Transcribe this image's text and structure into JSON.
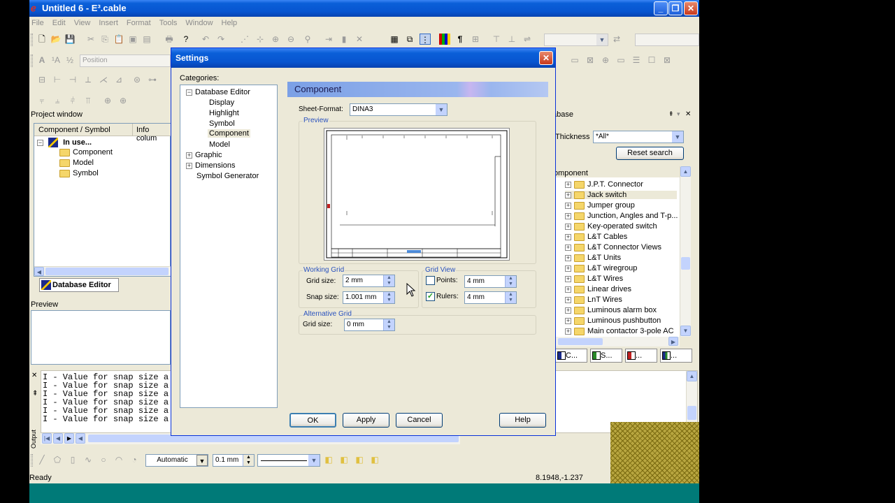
{
  "window": {
    "title": "Untitled 6 - E³.cable"
  },
  "menu": [
    "File",
    "Edit",
    "View",
    "Insert",
    "Format",
    "Tools",
    "Window",
    "Help"
  ],
  "toolbar": {
    "position_label": "Position"
  },
  "project_window": {
    "title": "Project window",
    "col1": "Component / Symbol",
    "col2": "Info colum",
    "root": "In use...",
    "children": [
      "Component",
      "Model",
      "Symbol"
    ],
    "tab": "Database Editor"
  },
  "preview_panel": {
    "title": "Preview"
  },
  "output": {
    "lines": [
      "I - Value for snap size a",
      "I - Value for snap size a",
      "I - Value for snap size a",
      "I - Value for snap size a",
      "I - Value for snap size a",
      "I - Value for snap size a"
    ],
    "label": "Output"
  },
  "bottom_toolbar": {
    "line_mode": "Automatic",
    "line_width": "0.1 mm"
  },
  "status": {
    "left": "Ready",
    "coords": "8.1948,-1.237"
  },
  "database": {
    "title": "abase",
    "thickness_label": "Thickness",
    "thickness_value": "*All*",
    "reset_label": "Reset search",
    "component_label": "omponent",
    "items": [
      "J.P.T. Connector",
      "Jack switch",
      "Jumper group",
      "Junction, Angles and T-p...",
      "Key-operated switch",
      "L&T Cables",
      "L&T Connector Views",
      "L&T Units",
      "L&T wiregroup",
      "L&T Wires",
      "Linear drives",
      "LnT Wires",
      "Luminous alarm box",
      "Luminous pushbutton",
      "Main contactor 3-pole AC"
    ],
    "tabs": [
      "C...",
      "S...",
      "...",
      "..."
    ]
  },
  "dialog": {
    "title": "Settings",
    "categories_label": "Categories:",
    "tree": {
      "root": "Database Editor",
      "children": [
        "Display",
        "Highlight",
        "Symbol",
        "Component",
        "Model"
      ],
      "others": [
        "Graphic",
        "Dimensions",
        "Symbol Generator"
      ]
    },
    "header": "Component",
    "sheet_format_label": "Sheet-Format:",
    "sheet_format_value": "DINA3",
    "preview_label": "Preview",
    "working_grid": {
      "label": "Working Grid",
      "grid_size_label": "Grid size:",
      "grid_size_value": "2 mm",
      "snap_size_label": "Snap size:",
      "snap_size_value": "1.001 mm"
    },
    "grid_view": {
      "label": "Grid View",
      "points_label": "Points:",
      "points_value": "4 mm",
      "points_checked": false,
      "rulers_label": "Rulers:",
      "rulers_value": "4 mm",
      "rulers_checked": true
    },
    "alt_grid": {
      "label": "Alternative Grid",
      "grid_size_label": "Grid size:",
      "grid_size_value": "0 mm"
    },
    "buttons": {
      "ok": "OK",
      "apply": "Apply",
      "cancel": "Cancel",
      "help": "Help"
    }
  }
}
